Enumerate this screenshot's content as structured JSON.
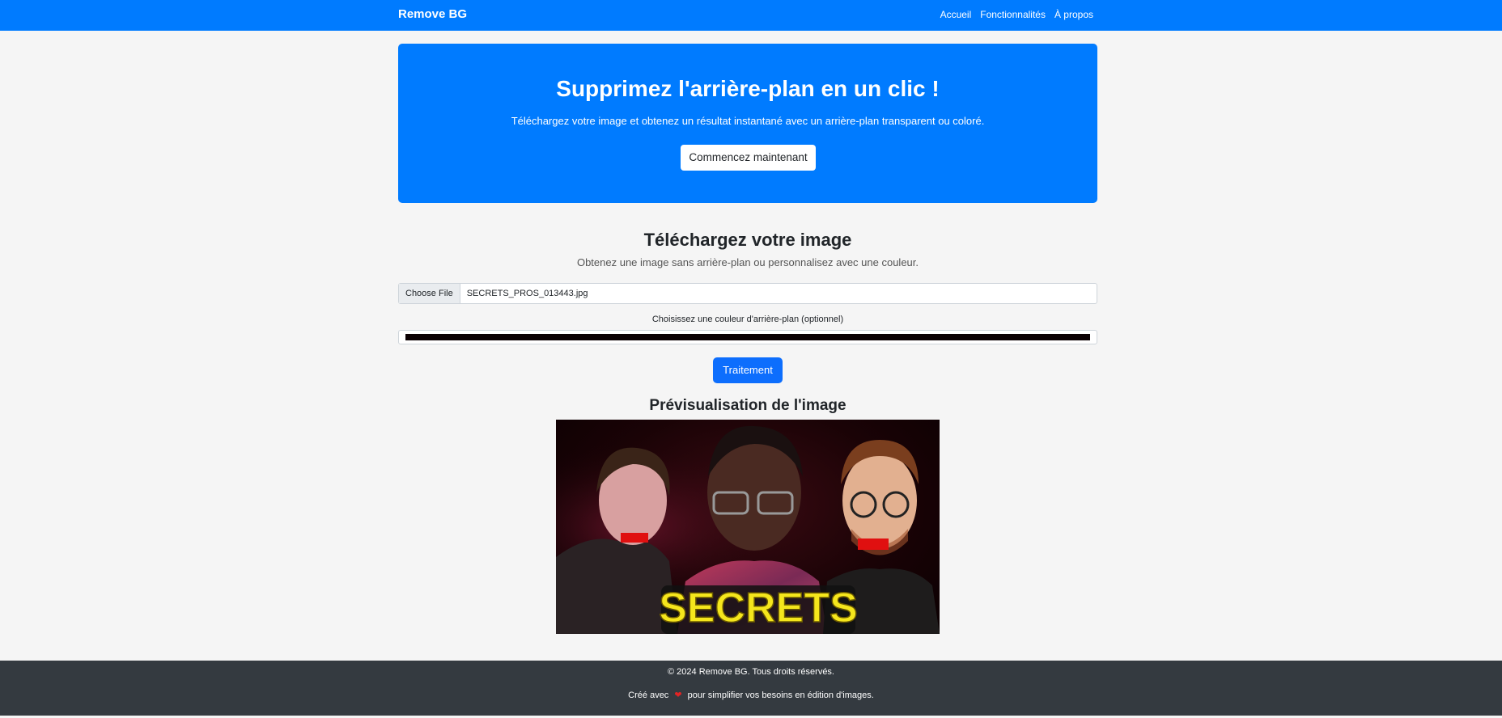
{
  "navbar": {
    "brand": "Remove BG",
    "links": [
      "Accueil",
      "Fonctionnalités",
      "À propos"
    ]
  },
  "hero": {
    "title": "Supprimez l'arrière-plan en un clic !",
    "subtitle": "Téléchargez votre image et obtenez un résultat instantané avec un arrière-plan transparent ou coloré.",
    "cta_label": "Commencez maintenant"
  },
  "upload": {
    "title": "Téléchargez votre image",
    "subtitle": "Obtenez une image sans arrière-plan ou personnalisez avec une couleur.",
    "file_button": "Choose File",
    "file_name": "SECRETS_PROS_013443.jpg",
    "color_label": "Choisissez une couleur d'arrière-plan (optionnel)",
    "color_value": "#0b0002",
    "process_label": "Traitement"
  },
  "preview": {
    "title": "Prévisualisation de l'image",
    "image_text": "SECRETS",
    "image_text_color": "#f5e61c"
  },
  "footer": {
    "line1": "© 2024 Remove BG. Tous droits réservés.",
    "line2_before": "Créé avec",
    "heart_icon": "heart-icon",
    "line2_after": "pour simplifier vos besoins en édition d'images."
  },
  "colors": {
    "primary": "#007bff",
    "button": "#0d6efd",
    "footer_bg": "#343a40",
    "page_bg": "#f5f5f5"
  }
}
